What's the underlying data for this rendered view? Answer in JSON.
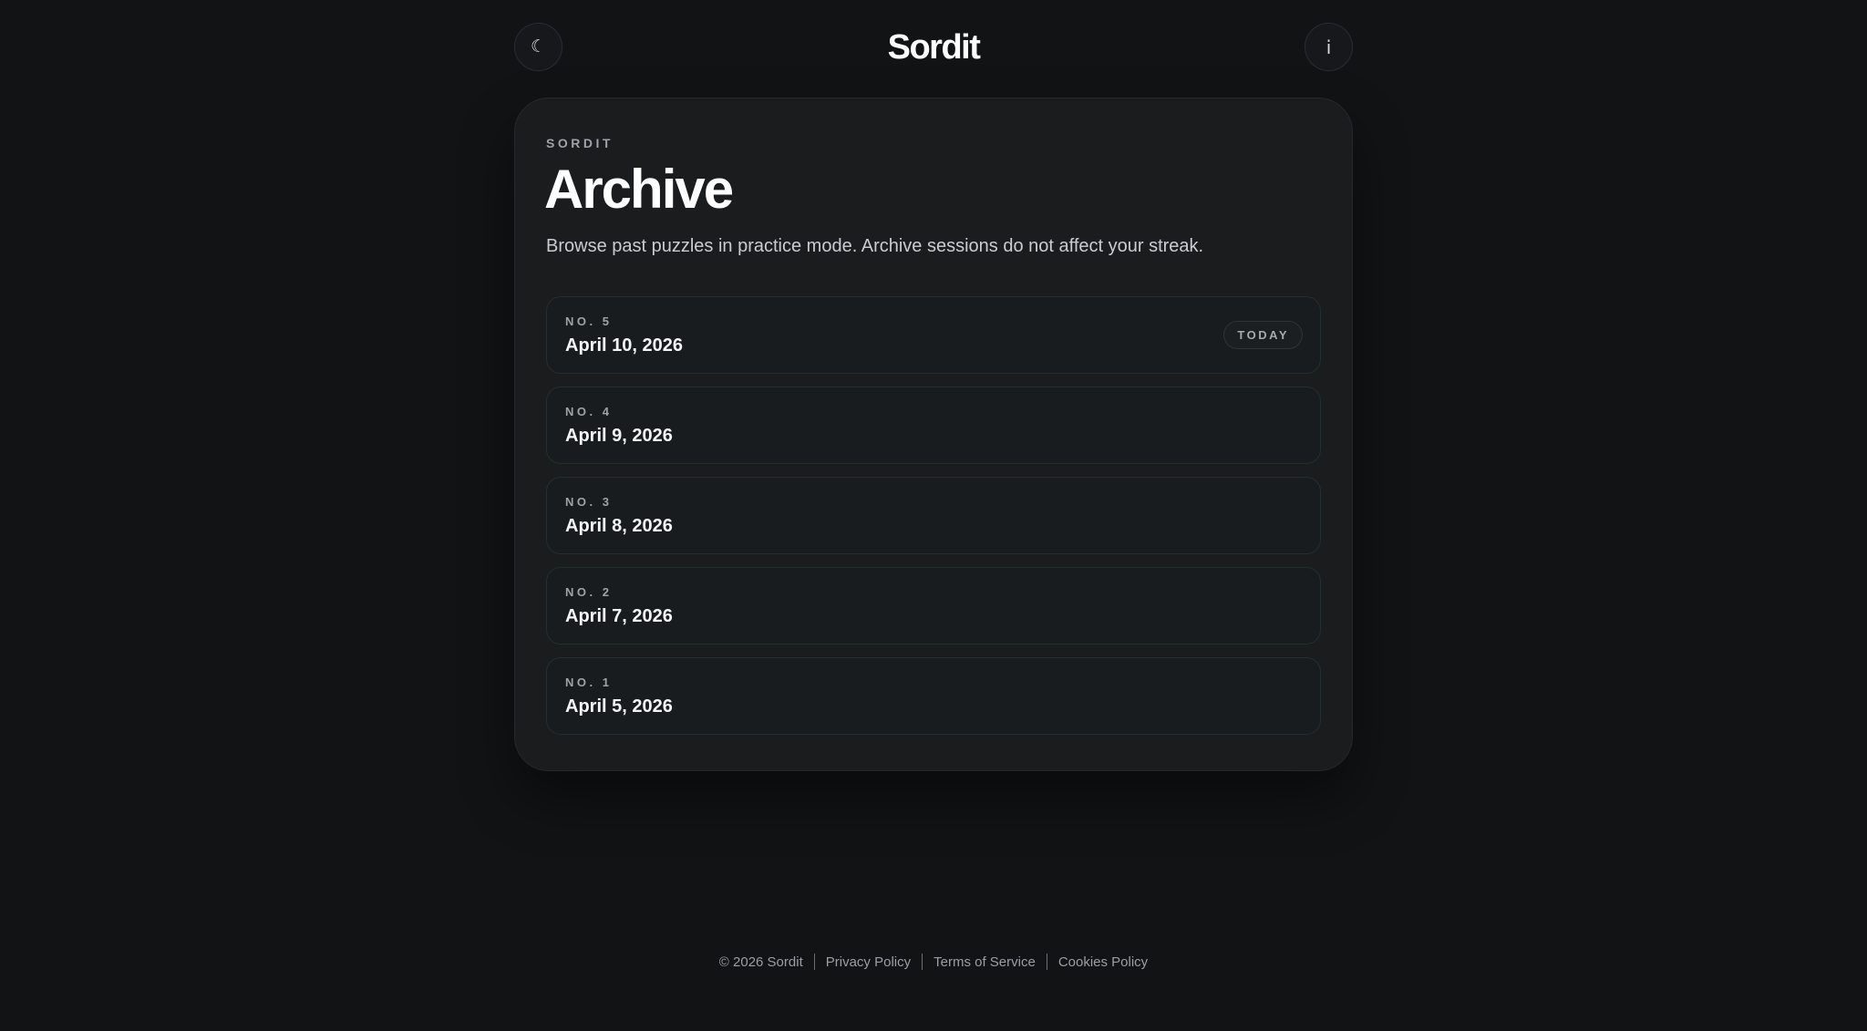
{
  "header": {
    "brand": "Sordit",
    "theme_icon": "☾",
    "info_icon": "i"
  },
  "card": {
    "eyebrow": "SORDIT",
    "title": "Archive",
    "subtitle": "Browse past puzzles in practice mode. Archive sessions do not affect your streak."
  },
  "archive": {
    "items": [
      {
        "number": "NO. 5",
        "date": "April 10, 2026",
        "badge": "TODAY"
      },
      {
        "number": "NO. 4",
        "date": "April 9, 2026"
      },
      {
        "number": "NO. 3",
        "date": "April 8, 2026"
      },
      {
        "number": "NO. 2",
        "date": "April 7, 2026"
      },
      {
        "number": "NO. 1",
        "date": "April 5, 2026"
      }
    ]
  },
  "footer": {
    "copyright": "© 2026 Sordit",
    "privacy": "Privacy Policy",
    "terms": "Terms of Service",
    "cookies": "Cookies Policy"
  }
}
